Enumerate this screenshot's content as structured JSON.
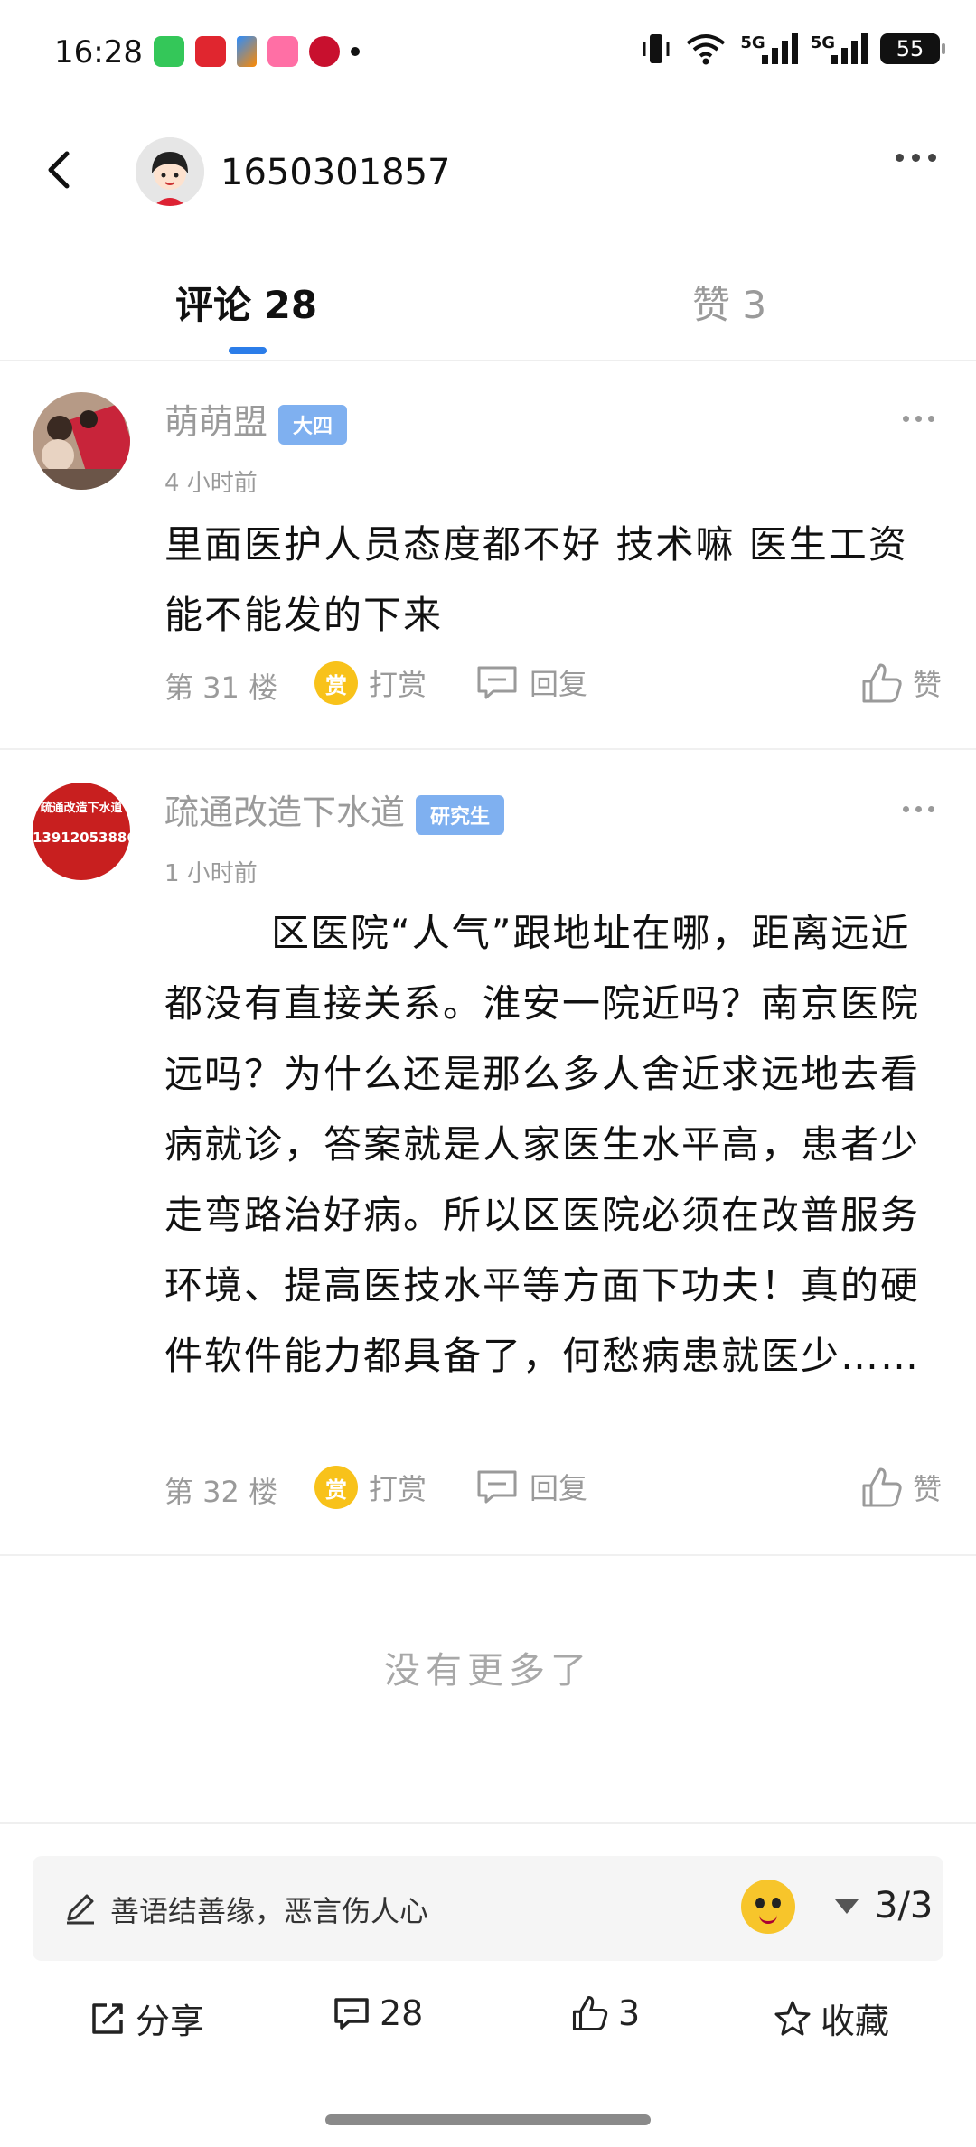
{
  "status_bar": {
    "time": "16:28",
    "network_1": "5G",
    "network_2": "5G",
    "battery": "55"
  },
  "header": {
    "title": "1650301857"
  },
  "tabs": {
    "comments": "评论 28",
    "likes": "赞 3"
  },
  "comments": [
    {
      "name": "萌萌盟",
      "badge": "大四",
      "time": "4 小时前",
      "text": "里面医护人员态度都不好 技术嘛 医生工资能不能发的下来",
      "floor": "第 31 楼",
      "reward_label": "打赏",
      "reward_icon_text": "赏",
      "reply_label": "回复",
      "like_label": "赞"
    },
    {
      "name": "疏通改造下水道",
      "badge": "研究生",
      "time": "1 小时前",
      "text": "区医院“人气”跟地址在哪，距离远近都没有直接关系。淮安一院近吗？南京医院远吗？为什么还是那么多人舍近求远地去看病就诊，答案就是人家医生水平高，患者少走弯路治好病。所以区医院必须在改普服务环境、提高医技水平等方面下功夫！真的硬件软件能力都具备了，何愁病患就医少……",
      "floor": "第 32 楼",
      "reward_label": "打赏",
      "reward_icon_text": "赏",
      "reply_label": "回复",
      "like_label": "赞",
      "avatar_sign_line1": "疏通改造下水道",
      "avatar_sign_line2": "13912053886"
    }
  ],
  "no_more": "没有更多了",
  "input": {
    "placeholder": "善语结善缘，恶言伤人心",
    "page": "3/3"
  },
  "bottom_bar": {
    "share": "分享",
    "comments": "28",
    "likes": "3",
    "favorite": "收藏"
  },
  "colors": {
    "accent": "#2b7de9",
    "badge": "#7fb0f0",
    "reward": "#f8c21a",
    "muted_text": "#9a9a9a"
  },
  "icons": [
    "back-arrow-icon",
    "more-dots-icon",
    "reward-coin-icon",
    "reply-bubble-icon",
    "thumbs-up-icon",
    "pen-icon",
    "emoji-icon",
    "dropdown-triangle-icon",
    "share-icon",
    "comment-icon",
    "star-icon"
  ]
}
